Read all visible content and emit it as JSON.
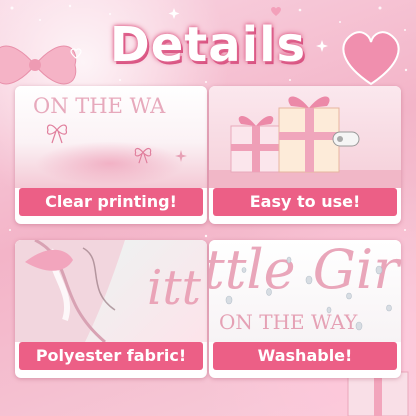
{
  "header": {
    "title": "Details"
  },
  "cards": [
    {
      "label": "Clear printing!",
      "photo_text": "ON THE WA"
    },
    {
      "label": "Easy to use!"
    },
    {
      "label": "Polyester fabric!",
      "photo_text": "itt"
    },
    {
      "label": "Washable!",
      "photo_text": "ttle Gir",
      "photo_subtext": "ON THE WAY"
    }
  ],
  "colors": {
    "label_bg": "#ec5f86",
    "title_glow": "#e26b92",
    "background": "#f3b4c8"
  },
  "icons": [
    "heart-icon",
    "sparkle-icon",
    "bow-icon",
    "gift-box-icon"
  ]
}
